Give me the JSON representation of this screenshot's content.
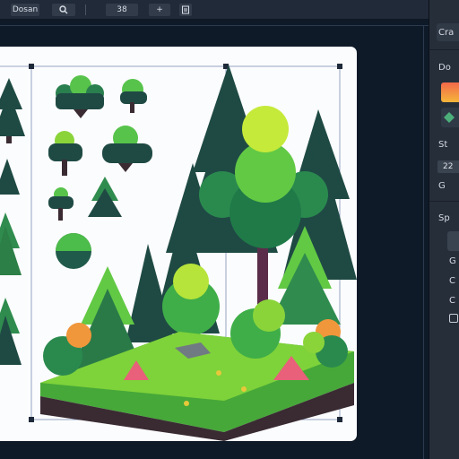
{
  "toolbar": {
    "mode_button": "Dosan",
    "zoom_value": "38",
    "add_button": "+"
  },
  "panel": {
    "section1_title": "Cra",
    "section2_title": "Do",
    "size_label": "St",
    "size_value": "22",
    "grid_label": "G",
    "section3_title": "Sp",
    "option1": "G",
    "option2": "C",
    "option3": "C",
    "colors": {
      "primary_swatch": "#f2694a",
      "secondary_swatch": "#4caf7a"
    }
  }
}
